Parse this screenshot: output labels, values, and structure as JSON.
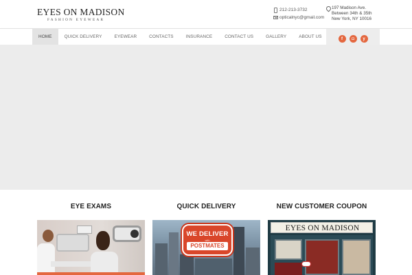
{
  "header": {
    "logo_title": "EYES ON MADISON",
    "logo_subtitle": "FASHION EYEWEAR",
    "phone": "212-213-3732",
    "email": "opticalnyc@gmail.com",
    "address_line1": "197 Madison Ave.",
    "address_line2": "Between 34th & 35th",
    "address_line3": "New York, NY 10016"
  },
  "nav": {
    "items": [
      {
        "label": "HOME",
        "active": true
      },
      {
        "label": "QUICK DELIVERY",
        "active": false
      },
      {
        "label": "EYEWEAR",
        "active": false
      },
      {
        "label": "CONTACTS",
        "active": false
      },
      {
        "label": "INSURANCE",
        "active": false
      },
      {
        "label": "CONTACT US",
        "active": false
      },
      {
        "label": "GALLERY",
        "active": false
      },
      {
        "label": "ABOUT US",
        "active": false
      }
    ]
  },
  "social": {
    "icons": [
      "facebook-icon",
      "instagram-icon",
      "yelp-icon"
    ],
    "facebook_glyph": "f",
    "instagram_glyph": "◘",
    "yelp_glyph": "y",
    "color": "#e4673f"
  },
  "columns": [
    {
      "title": "EYE EXAMS",
      "image": "eye-exam-photo"
    },
    {
      "title": "QUICK DELIVERY",
      "image": "we-deliver-postmates-photo"
    },
    {
      "title": "NEW CUSTOMER COUPON",
      "image": "storefront-photo"
    }
  ],
  "promo": {
    "badge_line1": "WE DELIVER",
    "badge_line_small": "with",
    "badge_line2": "POSTMATES",
    "store_sign": "EYES ON MADISON"
  },
  "colors": {
    "accent": "#e4673f",
    "hero_bg": "#ececec",
    "nav_active_bg": "#e3e3e3"
  }
}
